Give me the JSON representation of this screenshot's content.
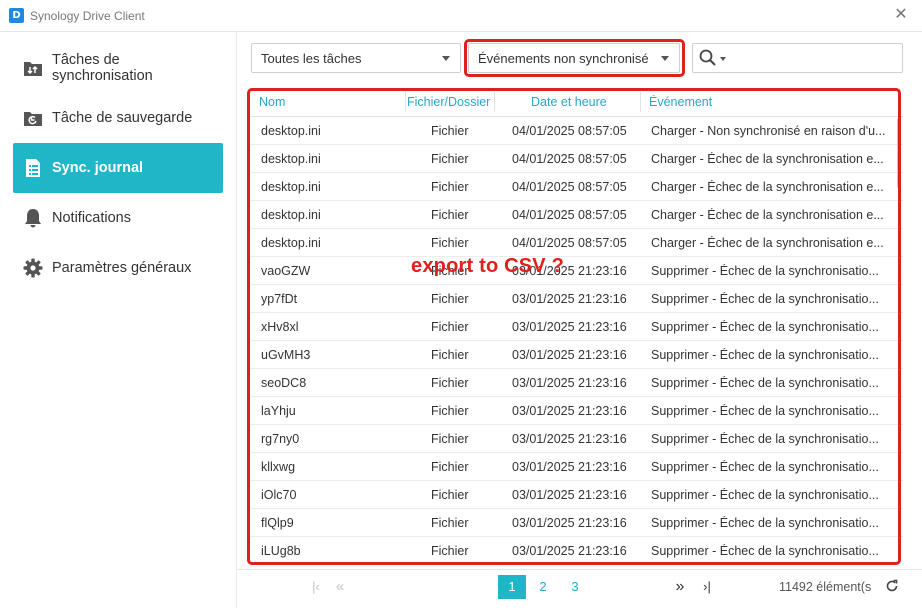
{
  "window": {
    "logo_text": "D",
    "title": "Synology Drive Client",
    "close_symbol": "✕"
  },
  "sidebar": {
    "items": [
      {
        "label": "Tâches de synchronisation",
        "icon": "sync-folder-icon",
        "active": false
      },
      {
        "label": "Tâche de sauvegarde",
        "icon": "backup-folder-icon",
        "active": false
      },
      {
        "label": "Sync. journal",
        "icon": "log-list-icon",
        "active": true
      },
      {
        "label": "Notifications",
        "icon": "bell-icon",
        "active": false
      },
      {
        "label": "Paramètres généraux",
        "icon": "gear-icon",
        "active": false
      }
    ]
  },
  "filters": {
    "tasks_value": "Toutes les tâches",
    "events_value": "Événements non synchronisé",
    "search_placeholder": ""
  },
  "table": {
    "columns": [
      "Nom",
      "Fichier/Dossier",
      "Date et heure",
      "Événement"
    ],
    "rows": [
      {
        "name": "desktop.ini",
        "type": "Fichier",
        "date": "04/01/2025 08:57:05",
        "event": "Charger - Non synchronisé en raison d'u..."
      },
      {
        "name": "desktop.ini",
        "type": "Fichier",
        "date": "04/01/2025 08:57:05",
        "event": "Charger - Échec de la synchronisation e..."
      },
      {
        "name": "desktop.ini",
        "type": "Fichier",
        "date": "04/01/2025 08:57:05",
        "event": "Charger - Échec de la synchronisation e..."
      },
      {
        "name": "desktop.ini",
        "type": "Fichier",
        "date": "04/01/2025 08:57:05",
        "event": "Charger - Échec de la synchronisation e..."
      },
      {
        "name": "desktop.ini",
        "type": "Fichier",
        "date": "04/01/2025 08:57:05",
        "event": "Charger - Échec de la synchronisation e..."
      },
      {
        "name": "vaoGZW",
        "type": "Fichier",
        "date": "03/01/2025 21:23:16",
        "event": "Supprimer - Échec de la synchronisatio..."
      },
      {
        "name": "yp7fDt",
        "type": "Fichier",
        "date": "03/01/2025 21:23:16",
        "event": "Supprimer - Échec de la synchronisatio..."
      },
      {
        "name": "xHv8xl",
        "type": "Fichier",
        "date": "03/01/2025 21:23:16",
        "event": "Supprimer - Échec de la synchronisatio..."
      },
      {
        "name": "uGvMH3",
        "type": "Fichier",
        "date": "03/01/2025 21:23:16",
        "event": "Supprimer - Échec de la synchronisatio..."
      },
      {
        "name": "seoDC8",
        "type": "Fichier",
        "date": "03/01/2025 21:23:16",
        "event": "Supprimer - Échec de la synchronisatio..."
      },
      {
        "name": "laYhju",
        "type": "Fichier",
        "date": "03/01/2025 21:23:16",
        "event": "Supprimer - Échec de la synchronisatio..."
      },
      {
        "name": "rg7ny0",
        "type": "Fichier",
        "date": "03/01/2025 21:23:16",
        "event": "Supprimer - Échec de la synchronisatio..."
      },
      {
        "name": "kllxwg",
        "type": "Fichier",
        "date": "03/01/2025 21:23:16",
        "event": "Supprimer - Échec de la synchronisatio..."
      },
      {
        "name": "iOlc70",
        "type": "Fichier",
        "date": "03/01/2025 21:23:16",
        "event": "Supprimer - Échec de la synchronisatio..."
      },
      {
        "name": "flQlp9",
        "type": "Fichier",
        "date": "03/01/2025 21:23:16",
        "event": "Supprimer - Échec de la synchronisatio..."
      },
      {
        "name": "iLUg8b",
        "type": "Fichier",
        "date": "03/01/2025 21:23:16",
        "event": "Supprimer - Échec de la synchronisatio..."
      }
    ]
  },
  "annotation": {
    "text": "export to CSV ?",
    "color": "#e0201b"
  },
  "pagination": {
    "first_symbol": "|‹",
    "prev_symbol": "«",
    "pages": [
      "1",
      "2",
      "3"
    ],
    "current_page": "1",
    "next_symbol": "»",
    "last_symbol": "›|",
    "count_text": "11492 élément(s)"
  },
  "colors": {
    "accent": "#1fb7c8",
    "header_text": "#27a8c8",
    "highlight": "#e0201b"
  }
}
